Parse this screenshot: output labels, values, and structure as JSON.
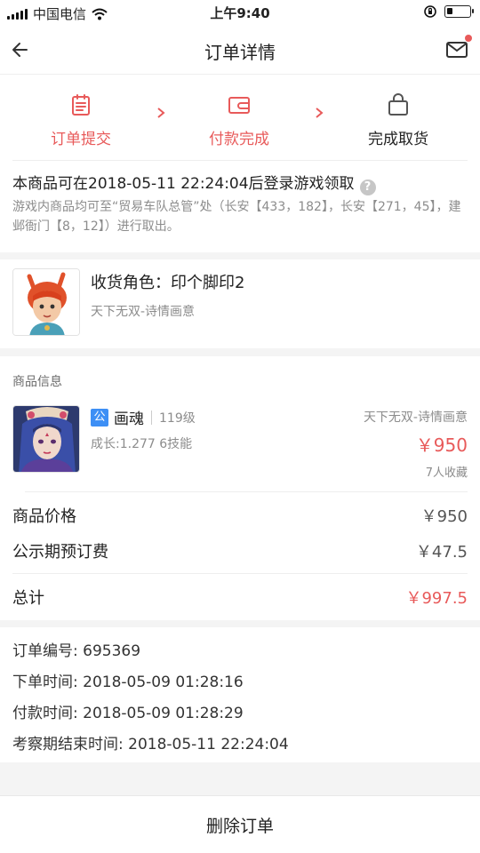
{
  "status_bar": {
    "carrier": "中国电信",
    "time": "上午9:40"
  },
  "navbar": {
    "title": "订单详情",
    "back_icon": "arrow-left-icon",
    "mail_icon": "mail-icon"
  },
  "progress": {
    "steps": [
      {
        "label": "订单提交",
        "icon": "clipboard-icon",
        "state": "done"
      },
      {
        "label": "付款完成",
        "icon": "wallet-icon",
        "state": "done"
      },
      {
        "label": "完成取货",
        "icon": "bag-icon",
        "state": "pending"
      }
    ],
    "notice": "本商品可在2018-05-11 22:24:04后登录游戏领取",
    "help_glyph": "?",
    "description": "游戏内商品均可至“贸易车队总管”处（长安【433，182】，长安【271，45】，建邺衙门【8，12】）进行取出。"
  },
  "receiver": {
    "label": "收货角色：印个脚印2",
    "server": "天下无双-诗情画意"
  },
  "goods": {
    "section_title": "商品信息",
    "tag": "公",
    "name": "画魂",
    "level": "119级",
    "server": "天下无双-诗情画意",
    "growth": "成长:1.277 6技能",
    "price": "￥950",
    "favorites": "7人收藏",
    "price_row": {
      "label": "商品价格",
      "value": "￥950"
    },
    "fee_row": {
      "label": "公示期预订费",
      "value": "￥47.5"
    },
    "total_row": {
      "label": "总计",
      "value": "￥997.5"
    }
  },
  "order_info": {
    "order_no": "订单编号:  695369",
    "order_time": "下单时间:  2018-05-09 01:28:16",
    "pay_time": "付款时间:  2018-05-09 01:28:29",
    "review_end": "考察期结束时间:  2018-05-11 22:24:04"
  },
  "actions": {
    "delete_order": "删除订单"
  },
  "colors": {
    "accent": "#e85a5a",
    "tag_blue": "#3d8ff5"
  }
}
